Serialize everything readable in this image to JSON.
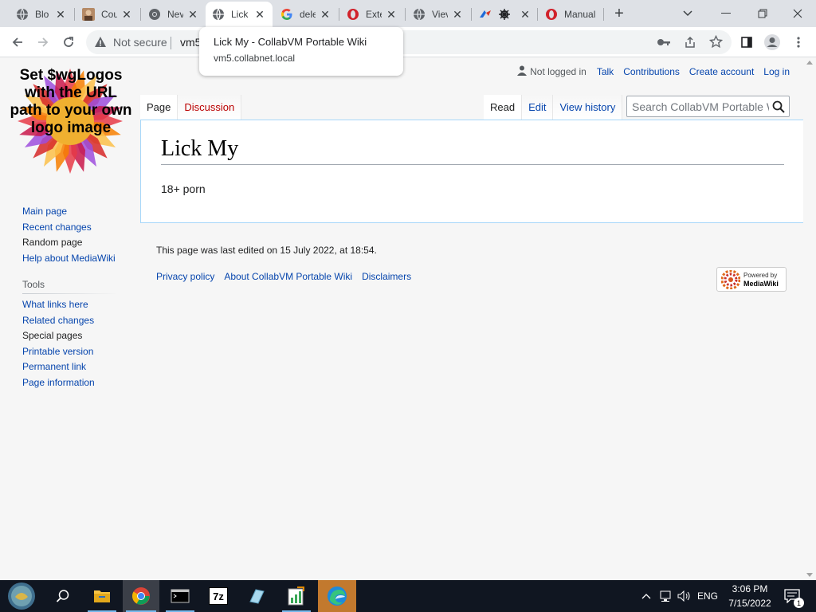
{
  "browser": {
    "tabs": [
      {
        "label": "Blo",
        "icon": "globe-icon"
      },
      {
        "label": "Cou",
        "icon": "avatar-icon"
      },
      {
        "label": "Nev",
        "icon": "chrome-icon"
      },
      {
        "label": "Lick",
        "icon": "globe-icon"
      },
      {
        "label": "dele",
        "icon": "google-icon"
      },
      {
        "label": "Exte",
        "icon": "opera-icon"
      },
      {
        "label": "Viev",
        "icon": "globe-icon"
      },
      {
        "label": "",
        "icon": "ship-wheel-icon"
      },
      {
        "label": "Manual",
        "icon": "opera-icon"
      }
    ],
    "active_tab": 3,
    "address": {
      "security_label": "Not secure",
      "url": "vm5"
    },
    "hovercard": {
      "title": "Lick My - CollabVM Portable Wiki",
      "url": "vm5.collabnet.local"
    }
  },
  "wiki": {
    "logo_text": "Set $wgLogos with the URL path to your own logo image",
    "personal": {
      "anon": "Not logged in",
      "links": [
        "Talk",
        "Contributions",
        "Create account",
        "Log in"
      ]
    },
    "namespaces": [
      {
        "label": "Page",
        "selected": true
      },
      {
        "label": "Discussion",
        "selected": false
      }
    ],
    "views": [
      {
        "label": "Read",
        "selected": true
      },
      {
        "label": "Edit",
        "selected": false
      },
      {
        "label": "View history",
        "selected": false
      }
    ],
    "search_placeholder": "Search CollabVM Portable Wiki",
    "title": "Lick My",
    "body": "18+ porn",
    "navigation": [
      {
        "label": "Main page"
      },
      {
        "label": "Recent changes"
      },
      {
        "label": "Random page"
      },
      {
        "label": "Help about MediaWiki"
      }
    ],
    "tools_heading": "Tools",
    "tools": [
      {
        "label": "What links here"
      },
      {
        "label": "Related changes"
      },
      {
        "label": "Special pages"
      },
      {
        "label": "Printable version"
      },
      {
        "label": "Permanent link"
      },
      {
        "label": "Page information"
      }
    ],
    "footer": {
      "last_modified": "This page was last edited on 15 July 2022, at 18:54.",
      "links": [
        "Privacy policy",
        "About CollabVM Portable Wiki",
        "Disclaimers"
      ],
      "powered_line1": "Powered by",
      "powered_line2": "MediaWiki"
    }
  },
  "taskbar": {
    "language": "ENG",
    "time": "3:06 PM",
    "date": "7/15/2022",
    "notification_count": "1",
    "seven_zip_label": "7z"
  },
  "colors": {
    "link": "#0645ad",
    "new_link": "#ba0000",
    "taskbar": "#101621",
    "tabstrip": "#dee1e6"
  }
}
